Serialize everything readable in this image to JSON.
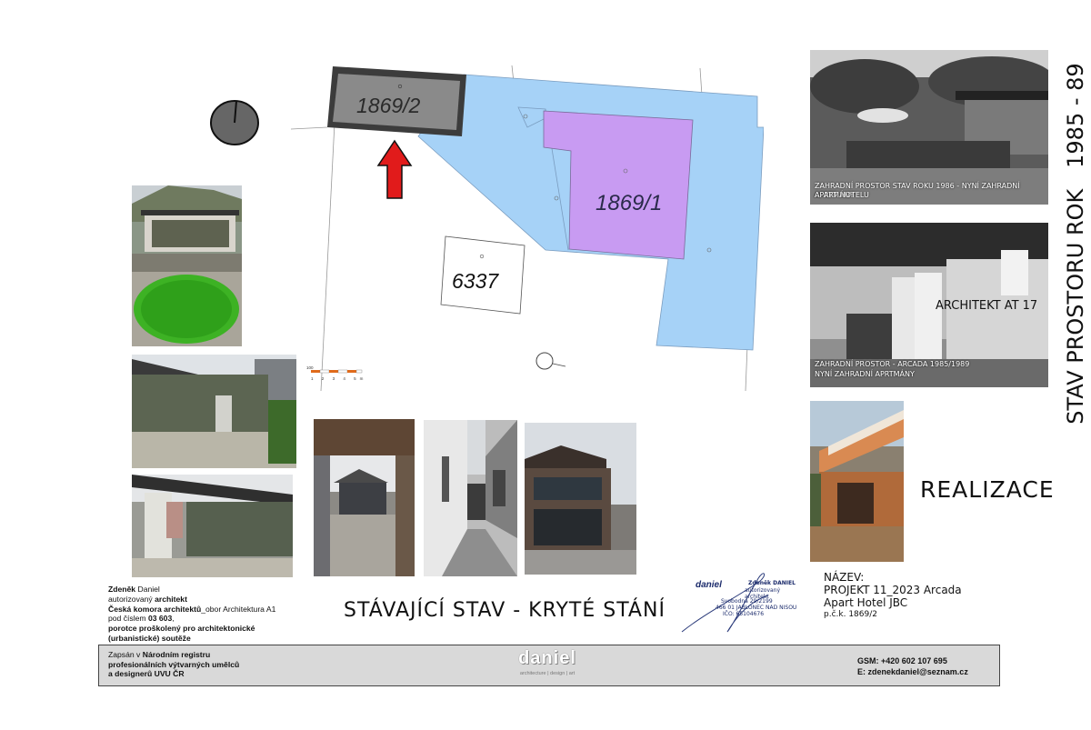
{
  "map": {
    "parcel_top": "1869/2",
    "parcel_main": "1869/1",
    "parcel_small": "6337",
    "scale_start": "100",
    "scale_ticks": [
      "1",
      "2",
      "3",
      "4",
      "5m"
    ]
  },
  "photos_right": {
    "photo1_caption_line1": "ZAHRADNÍ PROSTOR  STAV ROKU 1986 - NYNÍ ZAHRADNÍ APRTMÁNY",
    "photo1_caption_line2": "APART HOTELU",
    "photo2_overlay": "ARCHITEKT AT 17",
    "photo2_caption_line1": "ZAHRADNÍ PROSTOR - ARCADA 1985/1989",
    "photo2_caption_line2": "NYNÍ ZAHRADNÍ APRTMÁNY"
  },
  "vertical_title": "STAV PROSTORU ROK   1985 - 89",
  "realizace": "REALIZACE",
  "main_caption": "STÁVAJÍCÍ STAV - KRYTÉ STÁNÍ",
  "author": {
    "name_a": "Zdeněk",
    "name_b": " Daniel",
    "line2_a": "autorizovaný ",
    "line2_b": "architekt",
    "line3_a": "Česká komora architektů",
    "line3_b": "_obor Architektura A1",
    "line4_a": "pod číslem ",
    "line4_b": "03 603",
    "line4_c": ",",
    "line5_a": "porotce proš",
    "line5_b": "kolený pro architektonické",
    "line6": "(urbanistické) soutěže"
  },
  "project": {
    "label": "NÁZEV:",
    "line1": "PROJEKT 11_2023 Arcada",
    "line2": "Apart Hotel JBC",
    "line3": "p.č.k. 1869/2"
  },
  "stamp": {
    "logo": "daniel",
    "name": "Zdeněk DANIEL",
    "title": "autorizovaný architekt",
    "street": "Svobodná 29/2199",
    "city": "466 01  JABLONEC NAD NISOU",
    "ico": "IČO: 65104676"
  },
  "footer": {
    "reg_a": "Zapsán v ",
    "reg_b": "Národním registru",
    "reg_line2_a": "profesionálních výtvarných umě",
    "reg_line2_b": "lců",
    "reg_line3": "a designerů UVU ČR",
    "logo": "daniel",
    "tagline": "architecture  |  design  |  art",
    "gsm": "GSM: +420 602 107 695",
    "email": "E: zdenekdaniel@seznam.cz"
  }
}
